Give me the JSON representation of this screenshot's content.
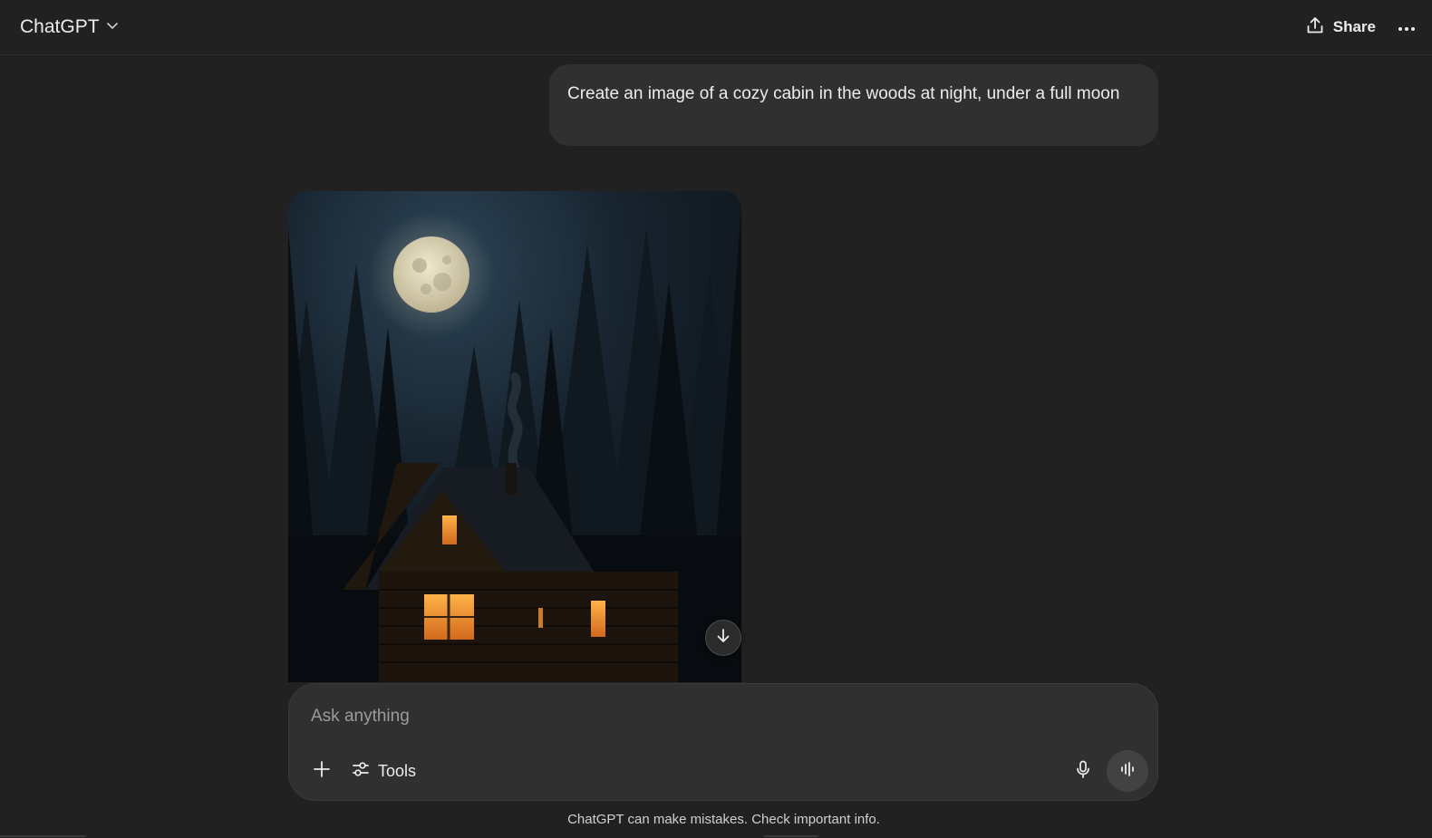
{
  "header": {
    "model_name": "ChatGPT",
    "share_label": "Share"
  },
  "conversation": {
    "user_message": "Create an image of a cozy cabin in the woods at night, under a full moon"
  },
  "composer": {
    "placeholder": "Ask anything",
    "tools_label": "Tools"
  },
  "footer": {
    "disclaimer": "ChatGPT can make mistakes. Check important info."
  },
  "colors": {
    "background": "#212121",
    "bubble": "#303030",
    "text": "#ececec"
  },
  "icons": [
    "chevron-down-icon",
    "share-icon",
    "more-icon",
    "arrow-down-icon",
    "plus-icon",
    "tools-icon",
    "mic-icon",
    "voice-waveform-icon"
  ]
}
